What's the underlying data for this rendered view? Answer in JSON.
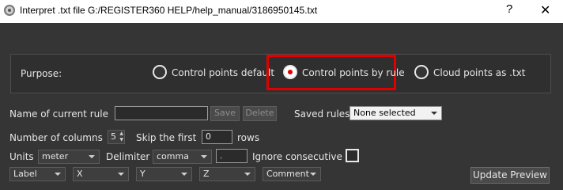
{
  "window": {
    "title": "Interpret .txt file G:/REGISTER360 HELP/help_manual/3186950145.txt",
    "help_glyph": "?",
    "close_glyph": "✕",
    "app_icon": "app-logo-icon"
  },
  "purpose": {
    "label": "Purpose:",
    "options": [
      {
        "label": "Control points default",
        "selected": false
      },
      {
        "label": "Control points by rule",
        "selected": true
      },
      {
        "label": "Cloud points as .txt",
        "selected": false
      }
    ],
    "highlight_color": "#e00000"
  },
  "rule": {
    "name_label": "Name of current rule",
    "name_value": "",
    "save_label": "Save",
    "delete_label": "Delete",
    "saved_rules_label": "Saved rules",
    "saved_rules_value": "None selected"
  },
  "columns": {
    "label": "Number of columns",
    "value": "5",
    "skip_label": "Skip the first",
    "skip_value": "0",
    "rows_label": "rows"
  },
  "units": {
    "label": "Units",
    "value": "meter",
    "delimiter_label": "Delimiter",
    "delimiter_value": "comma",
    "delimiter_char": ",",
    "ignore_label": "Ignore consecutive",
    "ignore_checked": false
  },
  "mapping": {
    "columns": [
      "Label",
      "X",
      "Y",
      "Z",
      "Comment"
    ],
    "update_label": "Update Preview"
  }
}
